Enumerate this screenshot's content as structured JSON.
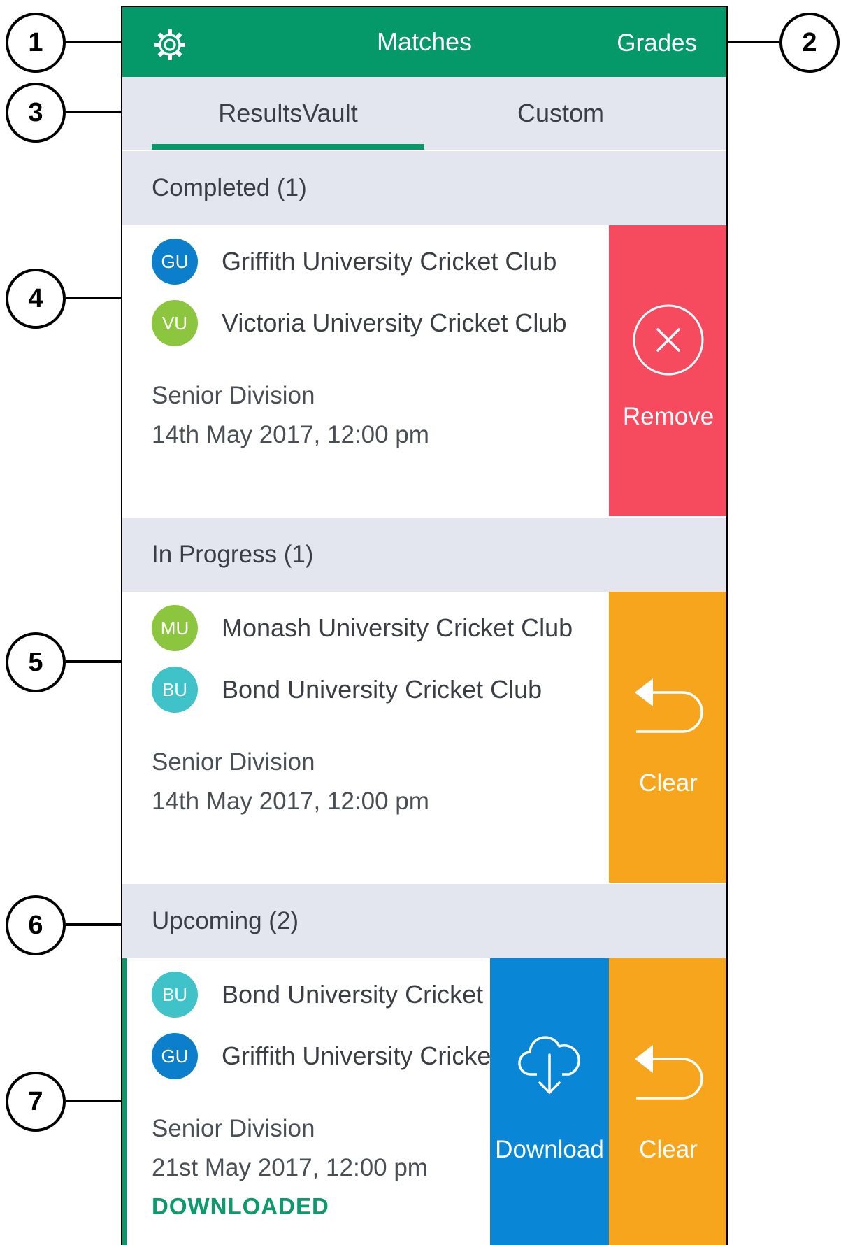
{
  "callouts": [
    "1",
    "2",
    "3",
    "4",
    "5",
    "6",
    "7"
  ],
  "topbar": {
    "title": "Matches",
    "grades_label": "Grades"
  },
  "tabs": [
    {
      "label": "ResultsVault",
      "active": true
    },
    {
      "label": "Custom",
      "active": false
    }
  ],
  "sections": {
    "completed": "Completed (1)",
    "in_progress": "In Progress (1)",
    "upcoming": "Upcoming (2)"
  },
  "matches": {
    "completed": {
      "teams": [
        {
          "initials": "GU",
          "name": "Griffith University Cricket Club",
          "color": "#0b7fcc"
        },
        {
          "initials": "VU",
          "name": "Victoria University Cricket Club",
          "color": "#8cc63f"
        }
      ],
      "division": "Senior Division",
      "datetime": "14th May 2017, 12:00 pm",
      "action_label": "Remove"
    },
    "in_progress": {
      "teams": [
        {
          "initials": "MU",
          "name": "Monash University Cricket Club",
          "color": "#8cc63f"
        },
        {
          "initials": "BU",
          "name": "Bond University Cricket Club",
          "color": "#3fc3c8"
        }
      ],
      "division": "Senior Division",
      "datetime": "14th May 2017, 12:00 pm",
      "action_label": "Clear"
    },
    "upcoming": {
      "teams": [
        {
          "initials": "BU",
          "name": "Bond University Cricket Club",
          "color": "#3fc3c8"
        },
        {
          "initials": "GU",
          "name": "Griffith University Cricket Club",
          "color": "#0b7fcc"
        }
      ],
      "division": "Senior Division",
      "datetime": "21st May 2017, 12:00 pm",
      "status": "DOWNLOADED",
      "download_label": "Download",
      "clear_label": "Clear"
    }
  },
  "colors": {
    "brand_green": "#059869",
    "remove_red": "#f64a5f",
    "clear_orange": "#f8a51e",
    "download_blue": "#0a86d6"
  }
}
